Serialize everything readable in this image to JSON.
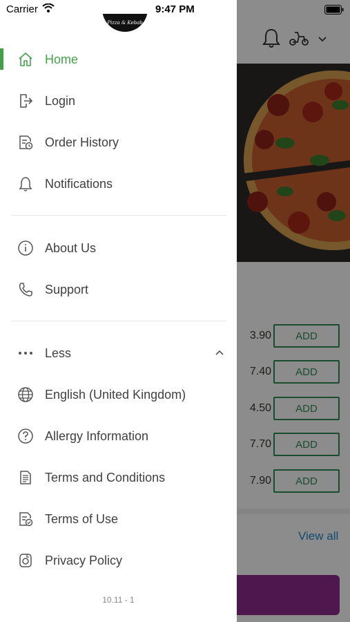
{
  "status_bar": {
    "carrier": "Carrier",
    "time": "9:47 PM"
  },
  "logo": {
    "text": "Pizza & Kebab"
  },
  "menu": {
    "home": "Home",
    "login": "Login",
    "order_history": "Order History",
    "notifications": "Notifications",
    "about_us": "About Us",
    "support": "Support",
    "less": "Less",
    "language": "English (United Kingdom)",
    "allergy": "Allergy Information",
    "terms_conditions": "Terms and Conditions",
    "terms_use": "Terms of Use",
    "privacy": "Privacy Policy"
  },
  "version": "10.11 - 1",
  "background": {
    "prices": [
      "3.90",
      "7.40",
      "4.50",
      "7.70",
      "7.90"
    ],
    "add_label": "ADD",
    "view_all": "View all"
  },
  "colors": {
    "accent": "#43a047",
    "add_border": "#2e8b57",
    "link": "#1e88c9",
    "purple": "#8e2a8c"
  }
}
